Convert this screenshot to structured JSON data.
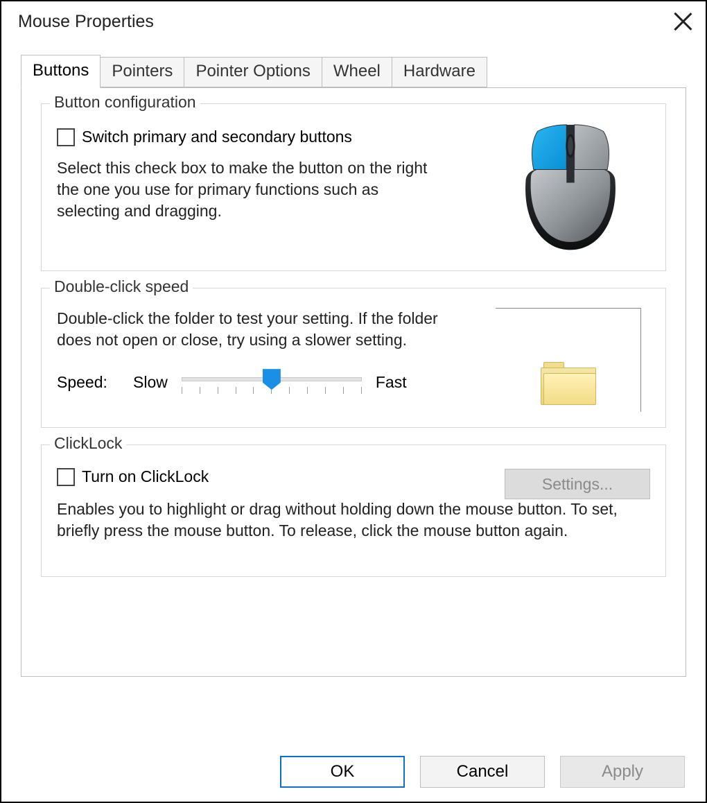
{
  "window": {
    "title": "Mouse Properties"
  },
  "tabs": [
    {
      "label": "Buttons",
      "active": true
    },
    {
      "label": "Pointers",
      "active": false
    },
    {
      "label": "Pointer Options",
      "active": false
    },
    {
      "label": "Wheel",
      "active": false
    },
    {
      "label": "Hardware",
      "active": false
    }
  ],
  "group_button_config": {
    "legend": "Button configuration",
    "switch_label": "Switch primary and secondary buttons",
    "switch_checked": false,
    "description": "Select this check box to make the button on the right the one you use for primary functions such as selecting and dragging."
  },
  "group_double_click": {
    "legend": "Double-click speed",
    "description": "Double-click the folder to test your setting. If the folder does not open or close, try using a slower setting.",
    "speed_label": "Speed:",
    "slow_label": "Slow",
    "fast_label": "Fast",
    "slider_position_percent": 50
  },
  "group_clicklock": {
    "legend": "ClickLock",
    "turn_on_label": "Turn on ClickLock",
    "turn_on_checked": false,
    "settings_button": "Settings...",
    "settings_enabled": false,
    "description": "Enables you to highlight or drag without holding down the mouse button. To set, briefly press the mouse button. To release, click the mouse button again."
  },
  "footer": {
    "ok": "OK",
    "cancel": "Cancel",
    "apply": "Apply",
    "apply_enabled": false
  },
  "colors": {
    "accent": "#1a8fe6",
    "primary_highlight": "#0aa7e0"
  }
}
